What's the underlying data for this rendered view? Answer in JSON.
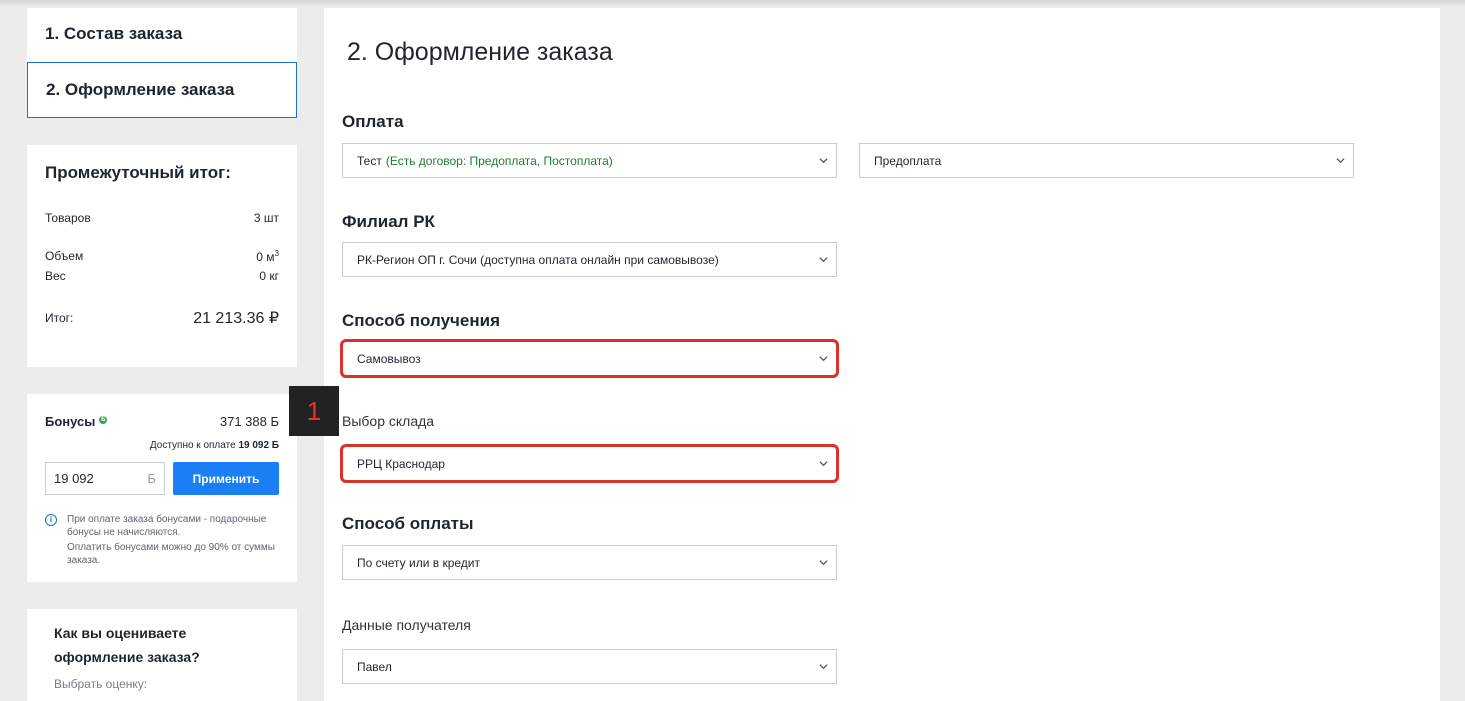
{
  "steps": {
    "step1": "1. Состав заказа",
    "step2": "2. Оформление заказа"
  },
  "summary": {
    "title": "Промежуточный итог:",
    "items_label": "Товаров",
    "items_value": "3 шт",
    "volume_label": "Объем",
    "volume_value": "0 м",
    "volume_unit_sup": "3",
    "weight_label": "Вес",
    "weight_value": "0 кг",
    "total_label": "Итог:",
    "total_value": "21 213.36 ₽"
  },
  "bonus": {
    "title": "Бонусы",
    "badge": "Б",
    "amount": "371 388 Б",
    "available_label": "Доступно к оплате",
    "available_value": "19 092 Б",
    "input_value": "19 092",
    "input_unit": "Б",
    "apply_label": "Применить",
    "note1": "При оплате заказа бонусами - подарочные бонусы не начисляются.",
    "note2": "Оплатить бонусами можно до 90% от суммы заказа."
  },
  "rating": {
    "title": "Как вы оцениваете оформление заказа?",
    "subtitle": "Выбрать оценку:"
  },
  "main": {
    "title": "2. Оформление заказа",
    "payment": {
      "label": "Оплата",
      "select1_value": "Тест",
      "select1_hint": "(Есть договор: Предоплата, Постоплата)",
      "select2_value": "Предоплата"
    },
    "branch": {
      "label": "Филиал РК",
      "value": "РК-Регион ОП г. Сочи (доступна оплата онлайн при самовывозе)"
    },
    "delivery": {
      "label": "Способ получения",
      "value": "Самовывоз"
    },
    "warehouse": {
      "label": "Выбор склада",
      "value": "РРЦ Краснодар"
    },
    "payment_method": {
      "label": "Способ оплаты",
      "value": "По счету или в кредит"
    },
    "recipient": {
      "label": "Данные получателя",
      "value": "Павел"
    }
  },
  "callout": {
    "number": "1"
  },
  "colors": {
    "accent": "#1a7ff5",
    "highlight": "#d9322a",
    "hint_green": "#1e7f2e"
  }
}
